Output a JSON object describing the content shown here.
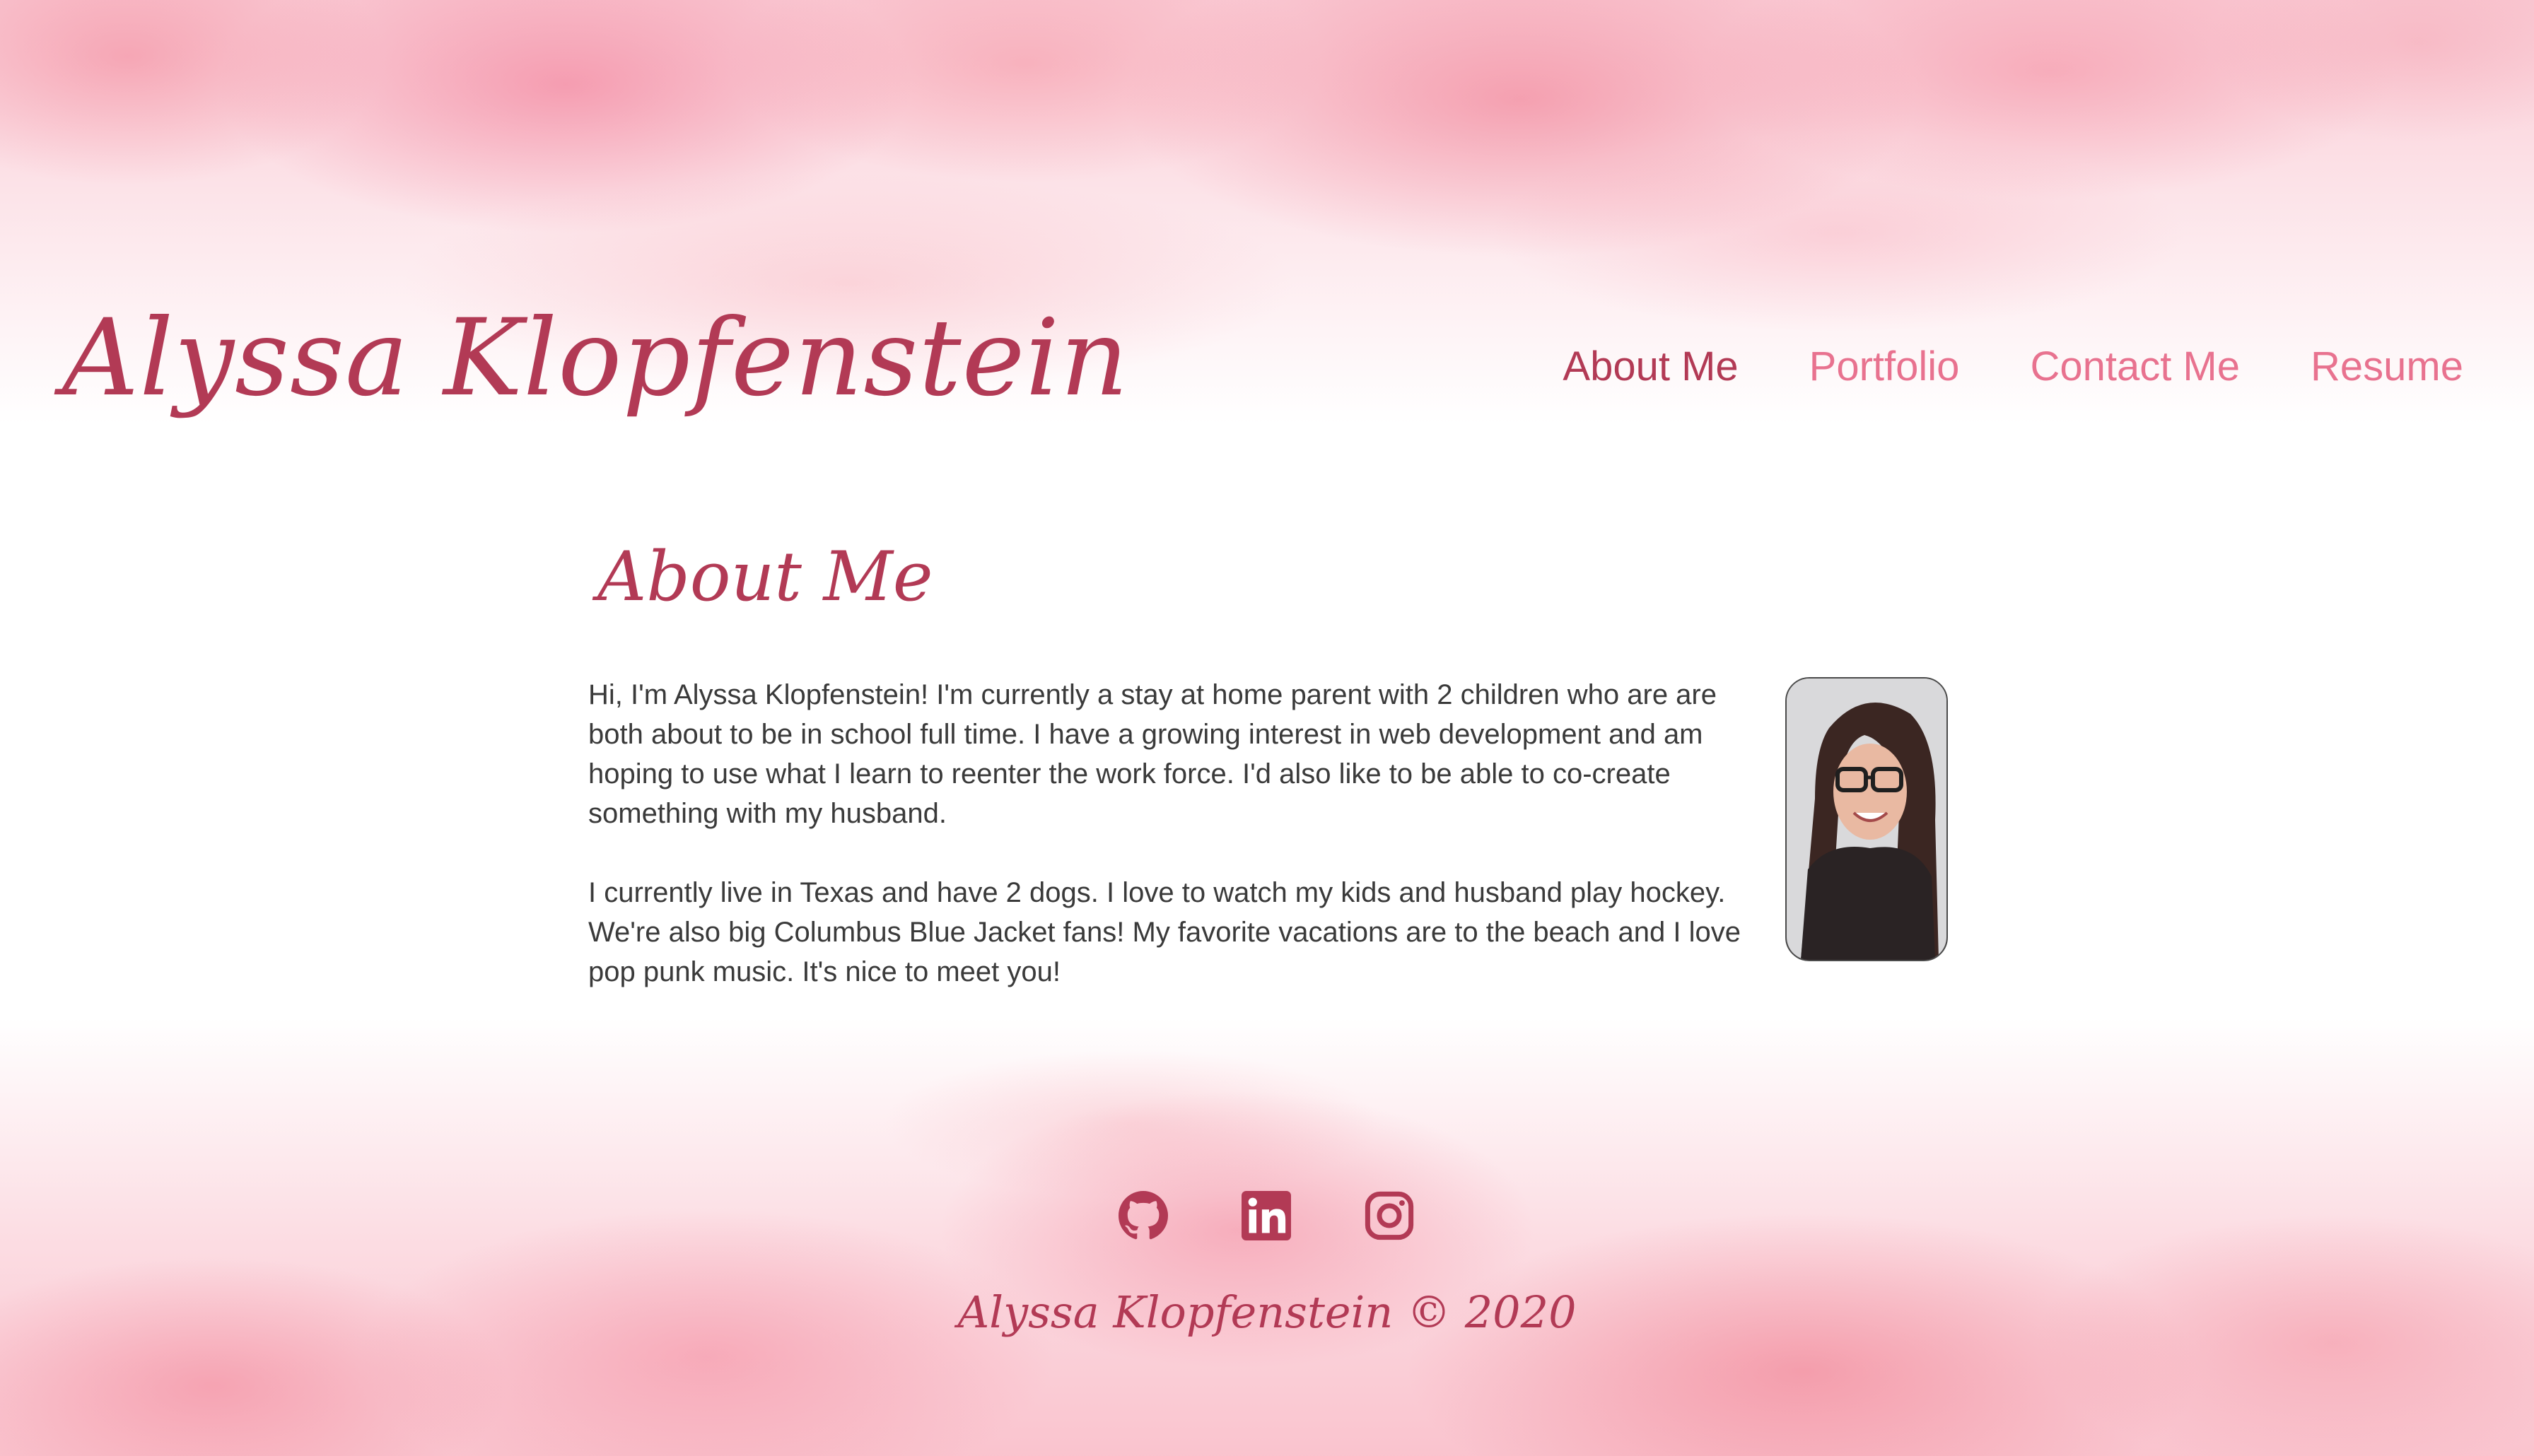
{
  "header": {
    "site_title": "Alyssa Klopfenstein",
    "nav": [
      {
        "label": "About Me",
        "active": true
      },
      {
        "label": "Portfolio",
        "active": false
      },
      {
        "label": "Contact Me",
        "active": false
      },
      {
        "label": "Resume",
        "active": false
      }
    ]
  },
  "main": {
    "section_title": "About Me",
    "paragraphs": [
      "Hi, I'm Alyssa Klopfenstein! I'm currently a stay at home parent with 2 children who are are both about to be in school full time. I have a growing interest in web development and am hoping to use what I learn to reenter the work force. I'd also like to be able to co-create something with my husband.",
      "I currently live in Texas and have 2 dogs. I love to watch my kids and husband play hockey. We're also big Columbus Blue Jacket fans! My favorite vacations are to the beach and I love pop punk music. It's nice to meet you!"
    ]
  },
  "footer": {
    "social_icons": [
      "github-icon",
      "linkedin-icon",
      "instagram-icon"
    ],
    "copyright": "Alyssa Klopfenstein © 2020"
  },
  "colors": {
    "accent": "#b23a55",
    "nav_link": "#e8728f",
    "body_text": "#3a3a3a",
    "wash": "#f4a3b5"
  }
}
